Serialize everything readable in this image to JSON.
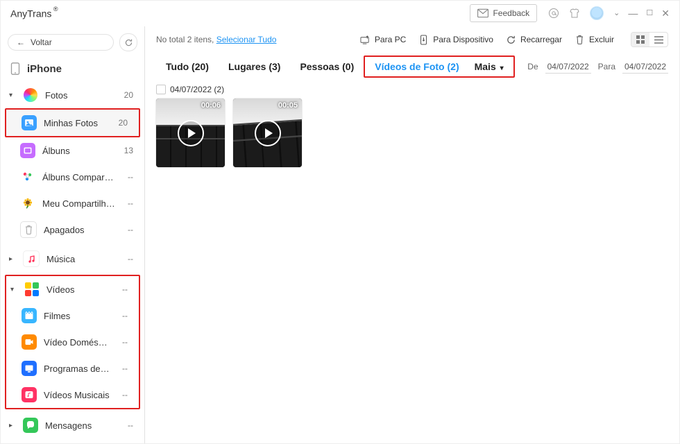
{
  "app_name": "AnyTrans",
  "titlebar": {
    "feedback": "Feedback"
  },
  "sidebar": {
    "back": "Voltar",
    "device": "iPhone",
    "groups": [
      {
        "id": "fotos",
        "caret": "▾",
        "label": "Fotos",
        "count": "20",
        "children": [
          {
            "id": "minhas-fotos",
            "label": "Minhas Fotos",
            "count": "20",
            "selected": true,
            "highlight": true
          },
          {
            "id": "albuns",
            "label": "Álbuns",
            "count": "13"
          },
          {
            "id": "albuns-comp",
            "label": "Álbuns Compartilhad…",
            "count": "--"
          },
          {
            "id": "meu-comp",
            "label": "Meu Compartilhame…",
            "count": "--"
          },
          {
            "id": "apagados",
            "label": "Apagados",
            "count": "--"
          }
        ]
      },
      {
        "id": "musica",
        "caret": "▸",
        "label": "Música",
        "count": "--"
      },
      {
        "id": "videos",
        "caret": "▾",
        "label": "Vídeos",
        "count": "--",
        "highlight_group": true,
        "children": [
          {
            "id": "filmes",
            "label": "Filmes",
            "count": "--"
          },
          {
            "id": "video-dom",
            "label": "Vídeo Doméstico",
            "count": "--"
          },
          {
            "id": "programas-tv",
            "label": "Programas de TV",
            "count": "--"
          },
          {
            "id": "videos-mus",
            "label": "Vídeos Musicais",
            "count": "--"
          }
        ]
      },
      {
        "id": "mensagens",
        "caret": "▸",
        "label": "Mensagens",
        "count": "--"
      }
    ]
  },
  "toolbar": {
    "total_text": "No total 2 itens, ",
    "select_all": "Selecionar Tudo",
    "to_pc": "Para PC",
    "to_device": "Para Dispositivo",
    "reload": "Recarregar",
    "delete": "Excluir"
  },
  "tabs": {
    "all": "Tudo (20)",
    "places": "Lugares (3)",
    "people": "Pessoas (0)",
    "video_photos": "Vídeos de Foto (2)",
    "more": "Mais"
  },
  "date_filter": {
    "from_label": "De",
    "from_value": "04/07/2022",
    "to_label": "Para",
    "to_value": "04/07/2022"
  },
  "content": {
    "group_title": "04/07/2022 (2)",
    "items": [
      {
        "duration": "00:06"
      },
      {
        "duration": "00:05"
      }
    ]
  }
}
